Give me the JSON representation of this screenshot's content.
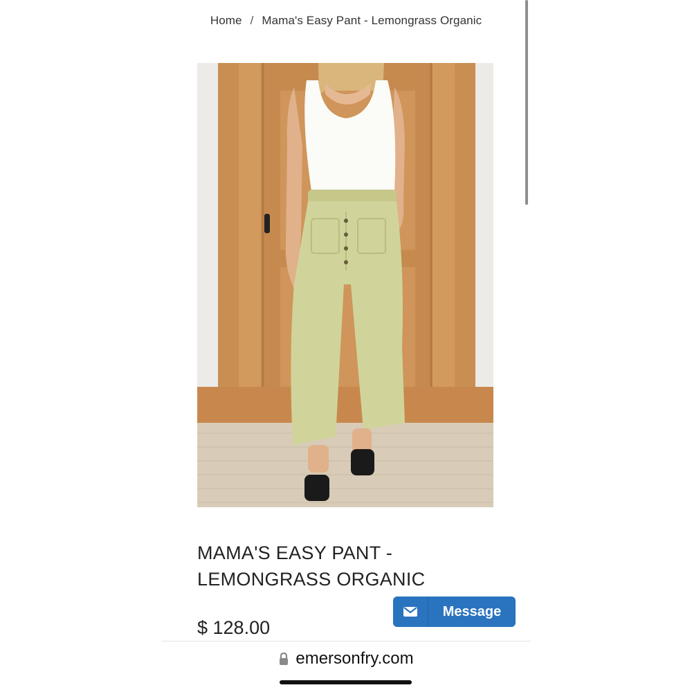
{
  "breadcrumb": {
    "home": "Home",
    "separator": "/",
    "current": "Mama's Easy Pant - Lemongrass Organic"
  },
  "product": {
    "title_line1": "MAMA'S EASY PANT -",
    "title_line2": "LEMONGRASS ORGANIC",
    "price": "$ 128.00",
    "image_alt": "Model wearing lemongrass wide-leg pants with white tank top and black sandals in front of a wooden door"
  },
  "message_button": {
    "label": "Message",
    "icon": "envelope-icon",
    "color": "#2a73be"
  },
  "browser": {
    "domain": "emersonfry.com",
    "icon": "lock-icon"
  }
}
